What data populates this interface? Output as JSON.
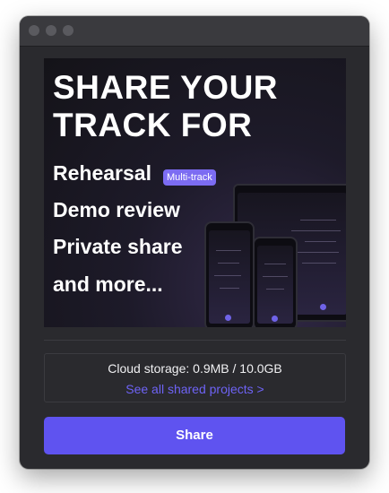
{
  "hero": {
    "title": "SHARE YOUR TRACK FOR",
    "uses": [
      "Rehearsal",
      "Demo review",
      "Private share",
      "and more..."
    ],
    "badge": "Multi-track"
  },
  "storage": {
    "label": "Cloud storage: 0.9MB / 10.0GB",
    "link": "See all shared projects >"
  },
  "actions": {
    "share": "Share"
  },
  "colors": {
    "accent": "#5f53f0",
    "link": "#6e63f5",
    "badge": "#7c6cf2",
    "window_bg": "#2a2a2e"
  }
}
